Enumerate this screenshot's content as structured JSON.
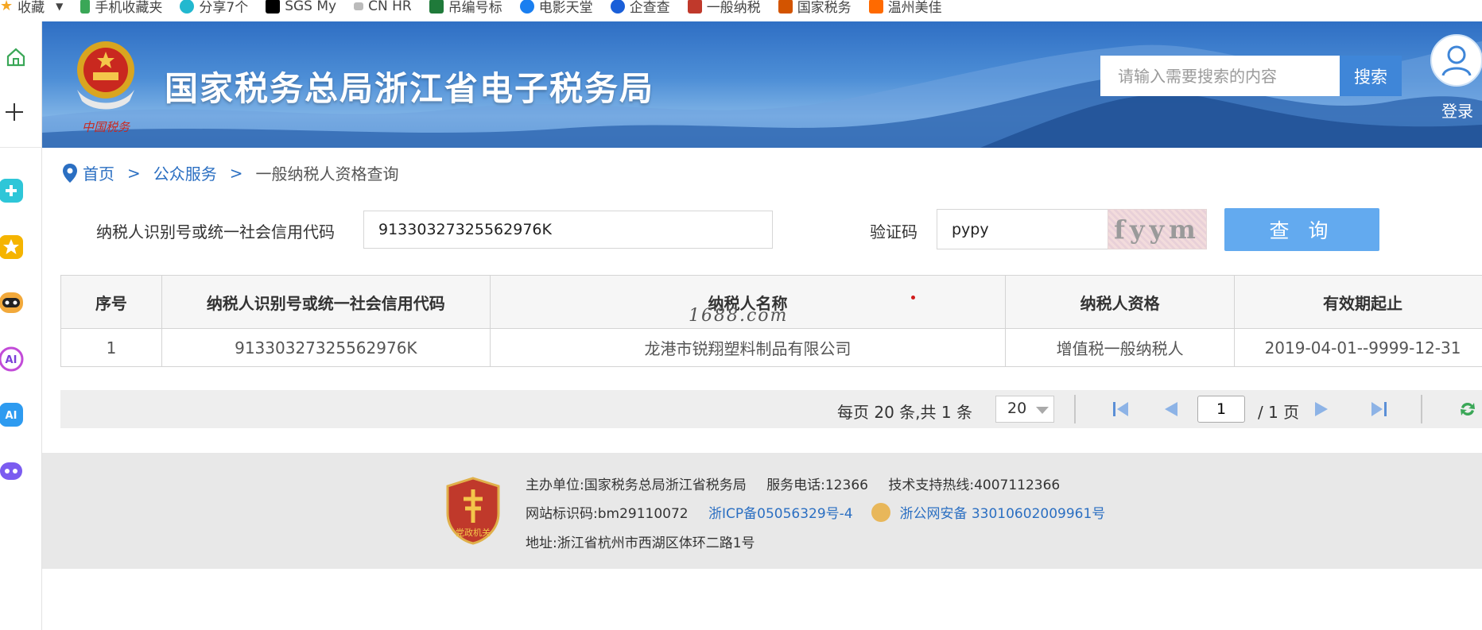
{
  "bookmarks": [
    {
      "label": "收藏",
      "color": "#f5a623"
    },
    {
      "label": "手机收藏夹",
      "color": "#3aa757"
    },
    {
      "label": "分享7个",
      "color": "#22b8cf"
    },
    {
      "label": "SGS My",
      "color": "#000000"
    },
    {
      "label": "CN HR",
      "color": "#888888"
    },
    {
      "label": "吊编号标",
      "color": "#1f7a3a"
    },
    {
      "label": "电影天堂",
      "color": "#1a7ff0"
    },
    {
      "label": "企查查",
      "color": "#1a5fd8"
    },
    {
      "label": "一般纳税",
      "color": "#c0392b"
    },
    {
      "label": "国家税务",
      "color": "#c0392b"
    },
    {
      "label": "温州美佳",
      "color": "#ff6a00"
    }
  ],
  "header": {
    "site_title": "国家税务总局浙江省电子税务局",
    "search_placeholder": "请输入需要搜索的内容",
    "search_button": "搜索",
    "login_label": "登录",
    "emblem_text": "中国税务"
  },
  "breadcrumb": {
    "home": "首页",
    "public_service": "公众服务",
    "current": "一般纳税人资格查询",
    "separator": ">"
  },
  "query_form": {
    "taxpayer_id_label": "纳税人识别号或统一社会信用代码",
    "taxpayer_id_value": "91330327325562976K",
    "captcha_label": "验证码",
    "captcha_value": "pypy",
    "captcha_image_text": "fyym",
    "query_button": "查 询"
  },
  "results_table": {
    "columns": [
      "序号",
      "纳税人识别号或统一社会信用代码",
      "纳税人名称",
      "纳税人资格",
      "有效期起止"
    ],
    "rows": [
      [
        "1",
        "91330327325562976K",
        "龙港市锐翔塑料制品有限公司",
        "增值税一般纳税人",
        "2019-04-01--9999-12-31"
      ]
    ],
    "watermark": "1688.com"
  },
  "pagination": {
    "summary": "每页 20 条,共 1 条",
    "page_size": "20",
    "current_page": "1",
    "total_pages": "/ 1 页"
  },
  "footer": {
    "host": "主办单位:国家税务总局浙江省税务局",
    "service_phone": "服务电话:12366",
    "support_hotline": "技术支持热线:4007112366",
    "site_id": "网站标识码:bm29110072",
    "icp": "浙ICP备05056329号-4",
    "police_record": "浙公网安备 33010602009961号",
    "address": "地址:浙江省杭州市西湖区体环二路1号",
    "badge_text": "党政机关"
  },
  "colors": {
    "brand_blue": "#2b6fc2",
    "query_button": "#63aaef",
    "search_button": "#3f86d8",
    "footer_bg": "#e8e8e8"
  }
}
